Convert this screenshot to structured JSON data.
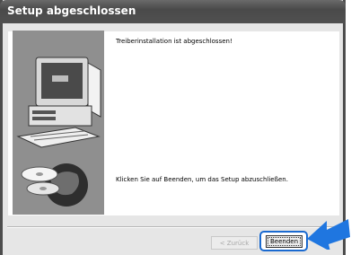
{
  "window": {
    "title": "Setup abgeschlossen"
  },
  "content": {
    "message_top": "Treiberinstallation ist abgeschlossen!",
    "message_bottom": "Klicken Sie auf Beenden, um das Setup abzuschließen."
  },
  "buttons": {
    "back_label": "< Zurück",
    "finish_label": "Beenden"
  },
  "colors": {
    "highlight": "#1a6ad0",
    "arrow": "#1f76e0"
  },
  "icons": {
    "artwork": "computer-with-cds-and-globe",
    "pointer": "arrow-left-icon"
  }
}
